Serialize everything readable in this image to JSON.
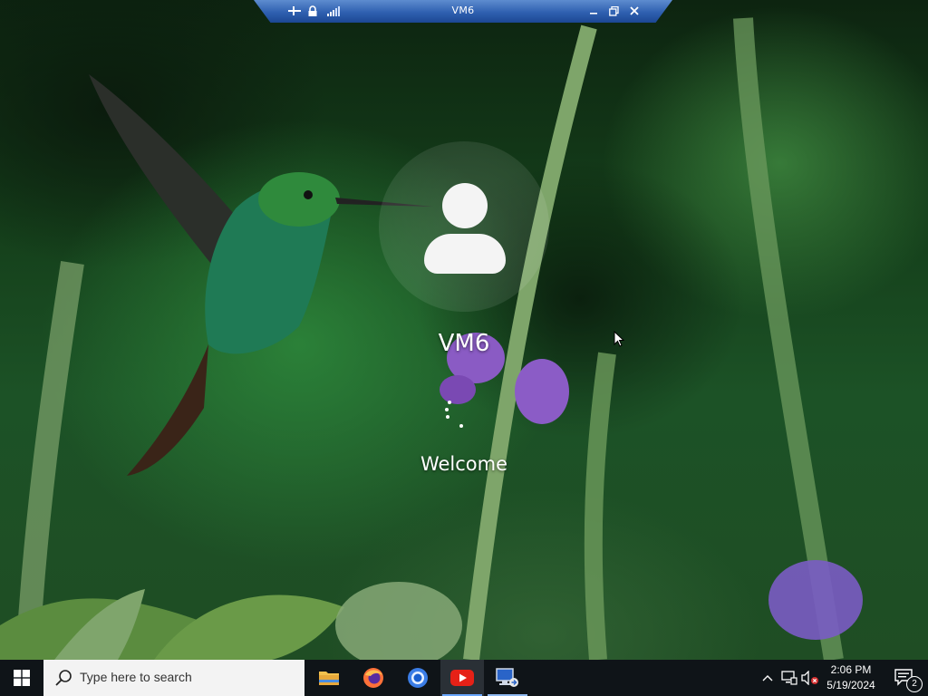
{
  "rdp_bar": {
    "title": "VM6",
    "icons": [
      "pin-icon",
      "lock-icon",
      "signal-icon",
      "minimize-icon",
      "restore-icon",
      "close-icon"
    ]
  },
  "login": {
    "user_name": "VM6",
    "status": "Welcome"
  },
  "taskbar": {
    "search_placeholder": "Type here to search",
    "apps": [
      {
        "name": "File Explorer",
        "icon": "folder-icon"
      },
      {
        "name": "Firefox",
        "icon": "firefox-icon"
      },
      {
        "name": "Chrome",
        "icon": "chrome-icon"
      },
      {
        "name": "YouTube",
        "icon": "youtube-icon"
      },
      {
        "name": "Remote Desktop",
        "icon": "remote-desktop-icon"
      }
    ],
    "tray": {
      "time": "2:06 PM",
      "date": "5/19/2024",
      "notification_count": "2"
    }
  },
  "colors": {
    "rdp_bar_blue": "#2f60b0",
    "taskbar_bg": "#0f1418",
    "accent": "#6aa7ff",
    "youtube_red": "#e62117"
  }
}
